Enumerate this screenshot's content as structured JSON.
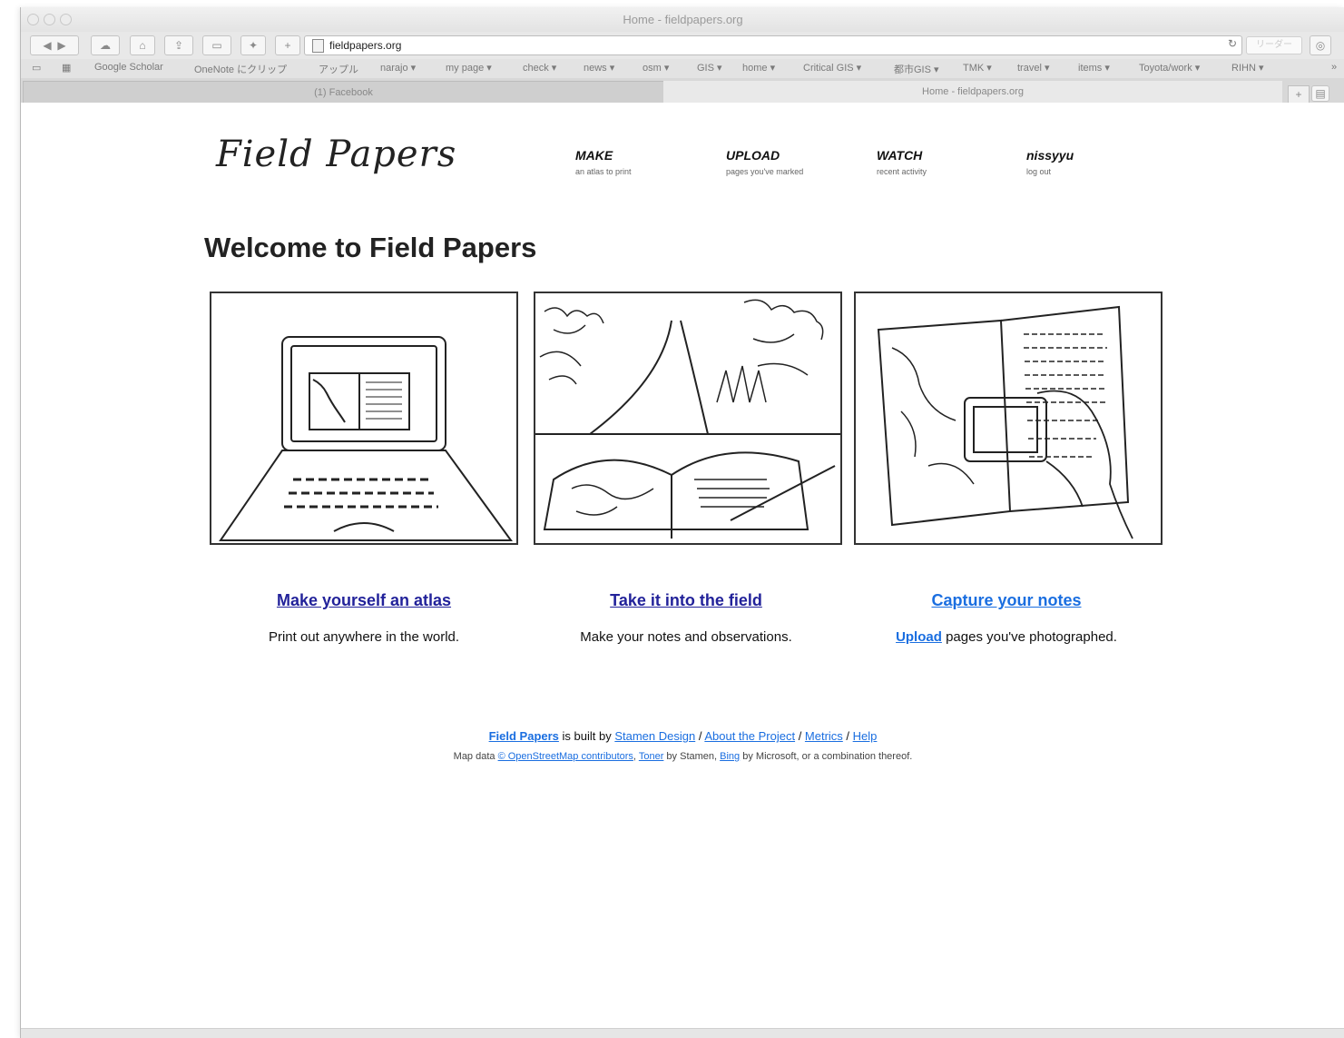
{
  "browser": {
    "window_title": "Home - fieldpapers.org",
    "url": "fieldpapers.org",
    "reader_label": "リーダー",
    "reload_icon": "reload-icon",
    "bookmarks": [
      "Google Scholar",
      "OneNote にクリップ",
      "アップル",
      "narajo ▾",
      "my page ▾",
      "check ▾",
      "news ▾",
      "osm ▾",
      "GIS ▾",
      "home ▾",
      "Critical GIS ▾",
      "都市GIS ▾",
      "TMK ▾",
      "travel ▾",
      "items ▾",
      "Toyota/work ▾",
      "RIHN ▾"
    ],
    "bookmarks_overflow": "»",
    "tabs": [
      "(1) Facebook",
      "Home - fieldpapers.org"
    ],
    "new_tab_label": "+"
  },
  "site": {
    "logo": "Field Papers",
    "nav": [
      {
        "label": "MAKE",
        "sub": "an atlas to print"
      },
      {
        "label": "UPLOAD",
        "sub": "pages you've marked"
      },
      {
        "label": "WATCH",
        "sub": "recent activity"
      },
      {
        "label": "nissyyu",
        "sub": "log out"
      }
    ],
    "welcome": "Welcome to Field Papers",
    "columns": [
      {
        "title": "Make yourself an atlas",
        "desc": "Print out anywhere in the world."
      },
      {
        "title": "Take it into the field",
        "desc": "Make your notes and observations."
      },
      {
        "title": "Capture your notes",
        "desc_link": "Upload",
        "desc": " pages you've photographed."
      }
    ],
    "footer": {
      "line1": {
        "brand": "Field Papers",
        "built_by": " is built by ",
        "stamen": "Stamen Design",
        "sep": " / ",
        "about": "About the Project",
        "metrics": "Metrics",
        "help": "Help"
      },
      "line2": {
        "prefix": "Map data ",
        "osm": "© OpenStreetMap contributors",
        "comma": ", ",
        "toner": "Toner",
        "by_stamen": " by Stamen, ",
        "bing": "Bing",
        "suffix": " by Microsoft, or a combination thereof."
      }
    }
  }
}
